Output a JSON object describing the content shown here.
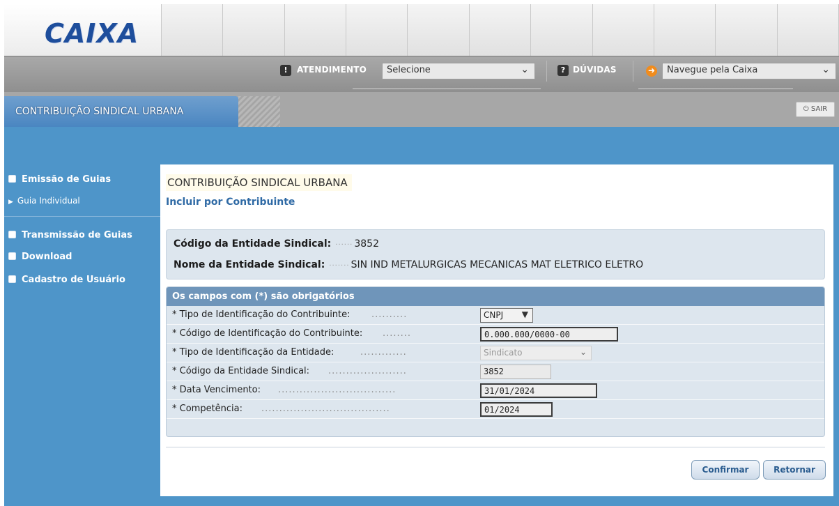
{
  "brand": {
    "logo": "CAIXA"
  },
  "nav": {
    "atendimento_label": "ATENDIMENTO",
    "atendimento_select": "Selecione",
    "duvidas_label": "DÚVIDAS",
    "navegue_select": "Navegue pela Caixa"
  },
  "tab": {
    "active_label": "CONTRIBUIÇÃO SINDICAL URBANA",
    "exit_label": "SAIR"
  },
  "sidebar": {
    "emissao": "Emissão de Guias",
    "guia_individual": "Guia Individual",
    "transmissao": "Transmissão de Guias",
    "download": "Download",
    "cadastro": "Cadastro de Usuário"
  },
  "panel": {
    "title": "CONTRIBUIÇÃO SINDICAL URBANA",
    "subtitle": "Incluir por Contribuinte"
  },
  "entity": {
    "code_label": "Código da Entidade Sindical:",
    "code_value": "3852",
    "name_label": "Nome da Entidade Sindical:",
    "name_value": "SIN IND METALURGICAS MECANICAS MAT ELETRICO ELETRO"
  },
  "form": {
    "header": "Os campos com (*) são obrigatórios",
    "tipo_contribuinte_label": "* Tipo de Identificação do Contribuinte:",
    "tipo_contribuinte_value": "CNPJ",
    "codigo_contribuinte_label": "* Código de Identificação do Contribuinte:",
    "codigo_contribuinte_value": "0.000.000/0000-00",
    "tipo_entidade_label": "* Tipo de Identificação da Entidade:",
    "tipo_entidade_value": "Sindicato",
    "codigo_entidade_label": "* Código da Entidade Sindical:",
    "codigo_entidade_value": "3852",
    "vencimento_label": "* Data Vencimento:",
    "vencimento_value": "31/01/2024",
    "competencia_label": "* Competência:",
    "competencia_value": "01/2024"
  },
  "buttons": {
    "confirm": "Confirmar",
    "back": "Retornar"
  },
  "colors": {
    "brand_blue": "#1e4e9c",
    "frame_blue": "#4e95c9",
    "header_blue": "#6f95ba",
    "link_blue": "#2f6aa5"
  }
}
